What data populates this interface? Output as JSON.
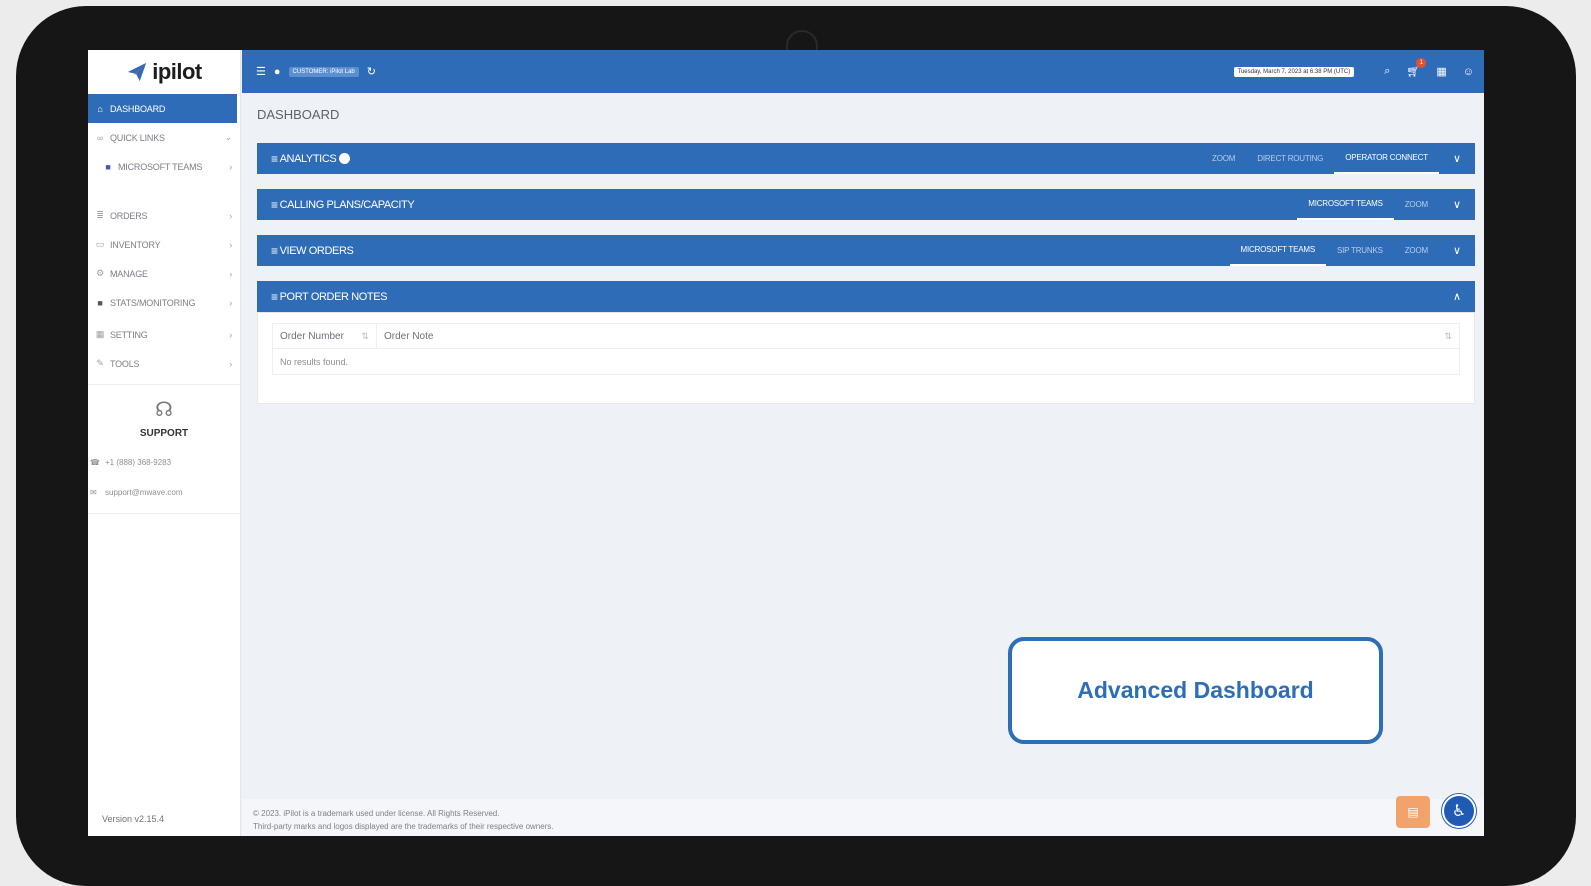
{
  "app": {
    "name": "ipilot",
    "version": "Version v2.15.4"
  },
  "topbar": {
    "customer": "CUSTOMER: iPilot Lab",
    "datetime": "Tuesday, March 7, 2023 at 6:38 PM (UTC)",
    "cart_count": "1",
    "icons": [
      "menu-icon",
      "info-icon",
      "refresh-icon",
      "search-icon",
      "cart-icon",
      "flag-icon",
      "user-icon"
    ]
  },
  "sidebar": {
    "items": [
      {
        "label": "DASHBOARD",
        "icon": "dashboard-icon"
      },
      {
        "label": "QUICK LINKS",
        "icon": "link-icon"
      },
      {
        "label": "MICROSOFT TEAMS",
        "icon": "teams-icon"
      },
      {
        "label": "ORDERS",
        "icon": "orders-icon"
      },
      {
        "label": "INVENTORY",
        "icon": "inventory-icon"
      },
      {
        "label": "MANAGE",
        "icon": "manage-icon"
      },
      {
        "label": "STATS/MONITORING",
        "icon": "stats-icon"
      },
      {
        "label": "SETTING",
        "icon": "setting-icon"
      },
      {
        "label": "TOOLS",
        "icon": "tools-icon"
      }
    ],
    "support": {
      "title": "SUPPORT",
      "phone": "+1 (888) 368-9283",
      "email": "support@mwave.com"
    }
  },
  "main": {
    "page_title": "DASHBOARD",
    "panels": [
      {
        "title": "ANALYTICS",
        "tabs": [
          "ZOOM",
          "DIRECT ROUTING",
          "OPERATOR CONNECT"
        ],
        "active_tab": "OPERATOR CONNECT"
      },
      {
        "title": "CALLING PLANS/CAPACITY",
        "tabs": [
          "MICROSOFT TEAMS",
          "ZOOM"
        ],
        "active_tab": "MICROSOFT TEAMS"
      },
      {
        "title": "VIEW ORDERS",
        "tabs": [
          "MICROSOFT TEAMS",
          "SIP TRUNKS",
          "ZOOM"
        ],
        "active_tab": "MICROSOFT TEAMS"
      },
      {
        "title": "PORT ORDER NOTES",
        "tabs": []
      }
    ],
    "port_table": {
      "columns": [
        "Order Number",
        "Order Note"
      ],
      "empty": "No results found."
    }
  },
  "callout": {
    "text": "Advanced Dashboard"
  },
  "footer": {
    "line1": "© 2023. iPilot is a trademark used under license. All Rights Reserved.",
    "line2": "Third-party marks and logos displayed are the trademarks of their respective owners."
  },
  "colors": {
    "primary": "#2f6cb8",
    "accent": "#2e6eb6",
    "badge": "#e5512f"
  }
}
